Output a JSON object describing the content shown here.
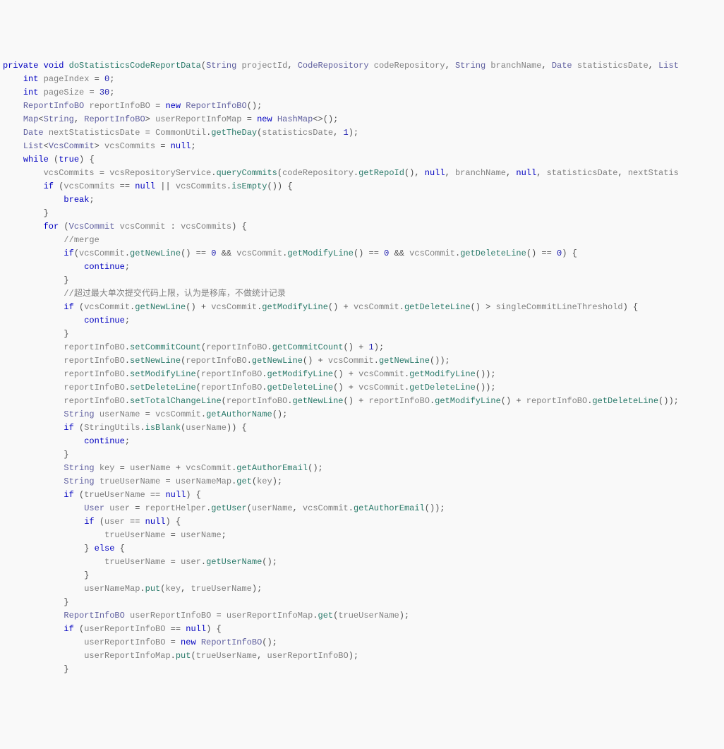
{
  "code": {
    "l01": {
      "a": "private",
      "b": "void",
      "c": "doStatisticsCodeReportData",
      "d": "String",
      "e": "projectId",
      "f": "CodeRepository",
      "g": "codeRepository",
      "h": "String",
      "i": "branchName",
      "j": "Date",
      "k": "statisticsDate",
      "l": "List"
    },
    "l02": {
      "a": "int",
      "b": "pageIndex",
      "c": "0"
    },
    "l03": {
      "a": "int",
      "b": "pageSize",
      "c": "30"
    },
    "l04": {
      "a": "ReportInfoBO",
      "b": "reportInfoBO",
      "c": "new",
      "d": "ReportInfoBO"
    },
    "l05": {
      "a": "Map",
      "b": "String",
      "c": "ReportInfoBO",
      "d": "userReportInfoMap",
      "e": "new",
      "f": "HashMap"
    },
    "l06": {
      "a": "Date",
      "b": "nextStatisticsDate",
      "c": "CommonUtil",
      "d": "getTheDay",
      "e": "statisticsDate",
      "f": "1"
    },
    "l07": {
      "a": "List",
      "b": "VcsCommit",
      "c": "vcsCommits",
      "d": "null"
    },
    "l08": {
      "a": "while",
      "b": "true"
    },
    "l09": {
      "a": "vcsCommits",
      "b": "vcsRepositoryService",
      "c": "queryCommits",
      "d": "codeRepository",
      "e": "getRepoId",
      "f": "null",
      "g": "branchName",
      "h": "null",
      "i": "statisticsDate",
      "j": "nextStatis"
    },
    "l10": {
      "a": "if",
      "b": "vcsCommits",
      "c": "null",
      "d": "vcsCommits",
      "e": "isEmpty"
    },
    "l11": {
      "a": "break"
    },
    "l12": {
      "a": "}"
    },
    "l13": {
      "a": "for",
      "b": "VcsCommit",
      "c": "vcsCommit",
      "d": "vcsCommits"
    },
    "l14": {
      "a": "//merge"
    },
    "l15": {
      "a": "if",
      "b": "vcsCommit",
      "c": "getNewLine",
      "d": "0",
      "e": "vcsCommit",
      "f": "getModifyLine",
      "g": "0",
      "h": "vcsCommit",
      "i": "getDeleteLine",
      "j": "0"
    },
    "l16": {
      "a": "continue"
    },
    "l17": {
      "a": "}"
    },
    "l18": {
      "a": "//超过最大单次提交代码上限，认为是移库，不做统计记录"
    },
    "l19": {
      "a": "if",
      "b": "vcsCommit",
      "c": "getNewLine",
      "d": "vcsCommit",
      "e": "getModifyLine",
      "f": "vcsCommit",
      "g": "getDeleteLine",
      "h": "singleCommitLineThreshold"
    },
    "l20": {
      "a": "continue"
    },
    "l21": {
      "a": "}"
    },
    "l22": {
      "a": "reportInfoBO",
      "b": "setCommitCount",
      "c": "reportInfoBO",
      "d": "getCommitCount",
      "e": "1"
    },
    "l23": {
      "a": "reportInfoBO",
      "b": "setNewLine",
      "c": "reportInfoBO",
      "d": "getNewLine",
      "e": "vcsCommit",
      "f": "getNewLine"
    },
    "l24": {
      "a": "reportInfoBO",
      "b": "setModifyLine",
      "c": "reportInfoBO",
      "d": "getModifyLine",
      "e": "vcsCommit",
      "f": "getModifyLine"
    },
    "l25": {
      "a": "reportInfoBO",
      "b": "setDeleteLine",
      "c": "reportInfoBO",
      "d": "getDeleteLine",
      "e": "vcsCommit",
      "f": "getDeleteLine"
    },
    "l26": {
      "a": "reportInfoBO",
      "b": "setTotalChangeLine",
      "c": "reportInfoBO",
      "d": "getNewLine",
      "e": "reportInfoBO",
      "f": "getModifyLine",
      "g": "reportInfoBO",
      "h": "getDeleteLine"
    },
    "l27": {
      "a": "String",
      "b": "userName",
      "c": "vcsCommit",
      "d": "getAuthorName"
    },
    "l28": {
      "a": "if",
      "b": "StringUtils",
      "c": "isBlank",
      "d": "userName"
    },
    "l29": {
      "a": "continue"
    },
    "l30": {
      "a": "}"
    },
    "l31": {
      "a": "String",
      "b": "key",
      "c": "userName",
      "d": "vcsCommit",
      "e": "getAuthorEmail"
    },
    "l32": {
      "a": "String",
      "b": "trueUserName",
      "c": "userNameMap",
      "d": "get",
      "e": "key"
    },
    "l33": {
      "a": "if",
      "b": "trueUserName",
      "c": "null"
    },
    "l34": {
      "a": "User",
      "b": "user",
      "c": "reportHelper",
      "d": "getUser",
      "e": "userName",
      "f": "vcsCommit",
      "g": "getAuthorEmail"
    },
    "l35": {
      "a": "if",
      "b": "user",
      "c": "null"
    },
    "l36": {
      "a": "trueUserName",
      "b": "userName"
    },
    "l37": {
      "a": "else"
    },
    "l38": {
      "a": "trueUserName",
      "b": "user",
      "c": "getUserName"
    },
    "l39": {
      "a": "}"
    },
    "l40": {
      "a": "userNameMap",
      "b": "put",
      "c": "key",
      "d": "trueUserName"
    },
    "l41": {
      "a": "}"
    },
    "l42": {
      "a": "ReportInfoBO",
      "b": "userReportInfoBO",
      "c": "userReportInfoMap",
      "d": "get",
      "e": "trueUserName"
    },
    "l43": {
      "a": "if",
      "b": "userReportInfoBO",
      "c": "null"
    },
    "l44": {
      "a": "userReportInfoBO",
      "b": "new",
      "c": "ReportInfoBO"
    },
    "l45": {
      "a": "userReportInfoMap",
      "b": "put",
      "c": "trueUserName",
      "d": "userReportInfoBO"
    },
    "l46": {
      "a": "}"
    }
  }
}
